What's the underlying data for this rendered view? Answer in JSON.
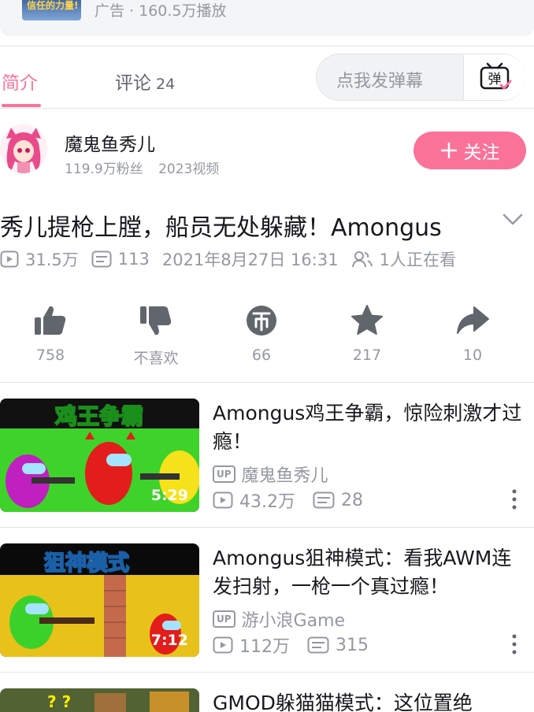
{
  "ad": {
    "thumb_text": "信任的力量!",
    "meta": "广告 · 160.5万播放"
  },
  "tabs": [
    {
      "label": "简介",
      "active": true
    },
    {
      "label": "评论",
      "count": "24",
      "active": false
    }
  ],
  "danmu": {
    "placeholder": "点我发弹幕",
    "button_label": "弹"
  },
  "uploader": {
    "name": "魔鬼鱼秀儿",
    "followers": "119.9万粉丝",
    "videos": "2023视频",
    "follow_label": "关注"
  },
  "video": {
    "title": "秀儿提枪上膛，船员无处躲藏！Amongus",
    "views": "31.5万",
    "danmaku": "113",
    "date": "2021年8月27日 16:31",
    "watching": "1人正在看"
  },
  "actions": [
    {
      "name": "like",
      "label": "758",
      "icon": "thumbs-up-icon"
    },
    {
      "name": "dislike",
      "label": "不喜欢",
      "icon": "thumbs-down-icon"
    },
    {
      "name": "coin",
      "label": "66",
      "icon": "coin-icon"
    },
    {
      "name": "favorite",
      "label": "217",
      "icon": "star-icon"
    },
    {
      "name": "share",
      "label": "10",
      "icon": "share-icon"
    }
  ],
  "recommendations": [
    {
      "title": "Amongus鸡王争霸，惊险刺激才过瘾！",
      "uploader": "魔鬼鱼秀儿",
      "views": "43.2万",
      "danmaku": "28",
      "duration": "5:29",
      "thumb_caption": "鸡王争霸",
      "up_badge": "UP"
    },
    {
      "title": "Amongus狙神模式：看我AWM连发扫射，一枪一个真过瘾！",
      "uploader": "游小浪Game",
      "views": "112万",
      "danmaku": "315",
      "duration": "7:12",
      "thumb_caption": "狙神模式",
      "up_badge": "UP"
    },
    {
      "title": "GMOD躲猫猫模式：这位置绝",
      "thumb_caption": "? ?"
    }
  ],
  "colors": {
    "accent": "#fb7299",
    "muted": "#9499a0",
    "text": "#18191c",
    "icon": "#61666d"
  }
}
